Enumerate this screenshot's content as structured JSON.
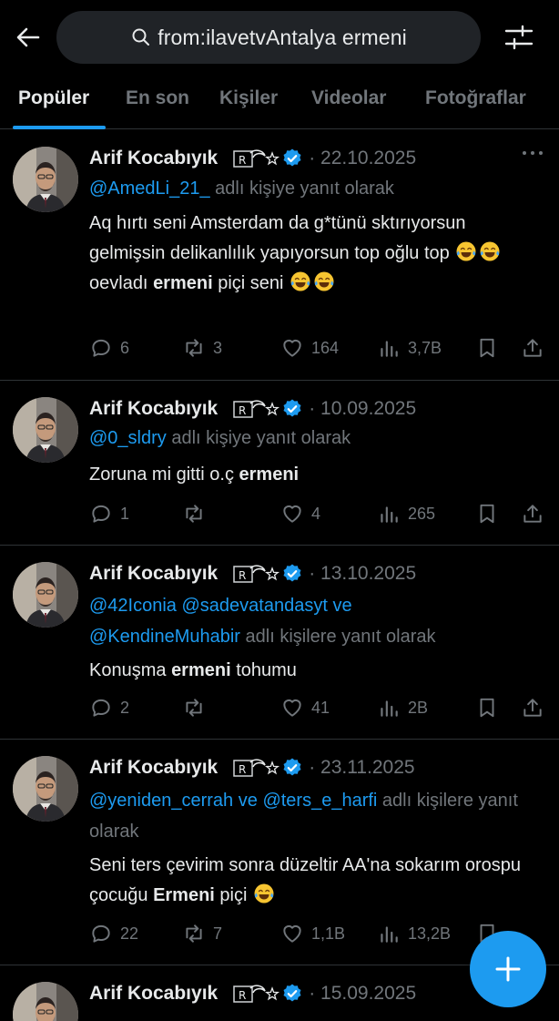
{
  "search": {
    "query": "from:ilavetvAntalya ermeni"
  },
  "tabs": [
    {
      "label": "Popüler"
    },
    {
      "label": "En son"
    },
    {
      "label": "Kişiler"
    },
    {
      "label": "Videolar"
    },
    {
      "label": "Fotoğraflar"
    }
  ],
  "colors": {
    "accent": "#1d9bf0",
    "muted": "#71767b",
    "text": "#e7e9ea",
    "bg": "#000000"
  },
  "tweets": [
    {
      "name": "Arif Kocabıyık",
      "date": "· 22.10.2025",
      "reply": {
        "handles": "@AmedLi_21_",
        "suffix": " adlı kişiye yanıt olarak"
      },
      "body": {
        "pre": "Aq hırtı seni Amsterdam da g*tünü sktırıyorsun gelmişsin delikanlılık yapıyorsun top oğlu top ",
        "mid": " oevladı ",
        "bold": "ermeni",
        "post": " piçi  seni "
      },
      "stats": {
        "replies": "6",
        "reposts": "3",
        "likes": "164",
        "views": "3,7B"
      }
    },
    {
      "name": "Arif Kocabıyık",
      "date": "· 10.09.2025",
      "reply": {
        "handles": "@0_sldry",
        "suffix": " adlı kişiye yanıt olarak"
      },
      "body": {
        "pre": "Zoruna mi gitti o.ç ",
        "bold": "ermeni"
      },
      "stats": {
        "replies": "1",
        "reposts": "",
        "likes": "4",
        "views": "265"
      }
    },
    {
      "name": "Arif Kocabıyık",
      "date": "· 13.10.2025",
      "reply": {
        "h1": "@42Iconia",
        "h2": "@sadevatandasyt",
        "connector": " ve",
        "h3": "@KendineMuhabir",
        "suffix": " adlı kişilere yanıt olarak"
      },
      "body": {
        "pre": "Konuşma ",
        "bold": "ermeni",
        "post": " tohumu"
      },
      "stats": {
        "replies": "2",
        "reposts": "",
        "likes": "41",
        "views": "2B"
      }
    },
    {
      "name": "Arif Kocabıyık",
      "date": "· 23.11.2025",
      "reply": {
        "h1": "@yeniden_cerrah",
        "connector": " ve ",
        "h2": "@ters_e_harfi",
        "suffix": " adlı kişilere yanıt olarak"
      },
      "body": {
        "pre": "Seni ters çevirim sonra düzeltir AA'na sokarım orospu çocuğu ",
        "bold": "Ermeni",
        "post": " piçi "
      },
      "stats": {
        "replies": "22",
        "reposts": "7",
        "likes": "1,1B",
        "views": "13,2B"
      }
    },
    {
      "name": "Arif Kocabıyık",
      "date": "· 15.09.2025"
    }
  ]
}
